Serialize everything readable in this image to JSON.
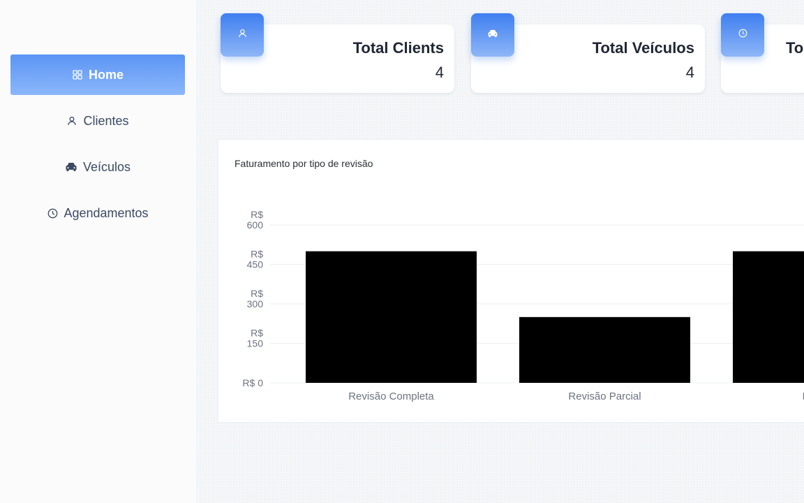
{
  "sidebar": {
    "items": [
      {
        "label": "Home",
        "icon": "grid-icon",
        "active": true
      },
      {
        "label": "Clientes",
        "icon": "user-icon",
        "active": false
      },
      {
        "label": "Veículos",
        "icon": "car-icon",
        "active": false
      },
      {
        "label": "Agendamentos",
        "icon": "clock-icon",
        "active": false
      }
    ]
  },
  "stats": [
    {
      "title": "Total Clients",
      "value": "4",
      "icon": "user-icon"
    },
    {
      "title": "Total Veículos",
      "value": "4",
      "icon": "car-icon"
    },
    {
      "title": "To",
      "value": "",
      "icon": "clock-icon"
    }
  ],
  "colors": {
    "accent": "#3f7ff0",
    "accent_light": "#8db6f7",
    "bar": "#000000"
  },
  "chart_data": {
    "type": "bar",
    "title": "Faturamento por tipo de revisão",
    "categories": [
      "Revisão Completa",
      "Revisão Parcial",
      "Revisã"
    ],
    "values": [
      500,
      250,
      500
    ],
    "ylim": [
      0,
      600
    ],
    "yticks": [
      {
        "value": 0,
        "label": [
          "R$ 0"
        ]
      },
      {
        "value": 150,
        "label": [
          "R$",
          "150"
        ]
      },
      {
        "value": 300,
        "label": [
          "R$",
          "300"
        ]
      },
      {
        "value": 450,
        "label": [
          "R$",
          "450"
        ]
      },
      {
        "value": 600,
        "label": [
          "R$",
          "600"
        ]
      }
    ],
    "grid": true,
    "legend": "none"
  }
}
